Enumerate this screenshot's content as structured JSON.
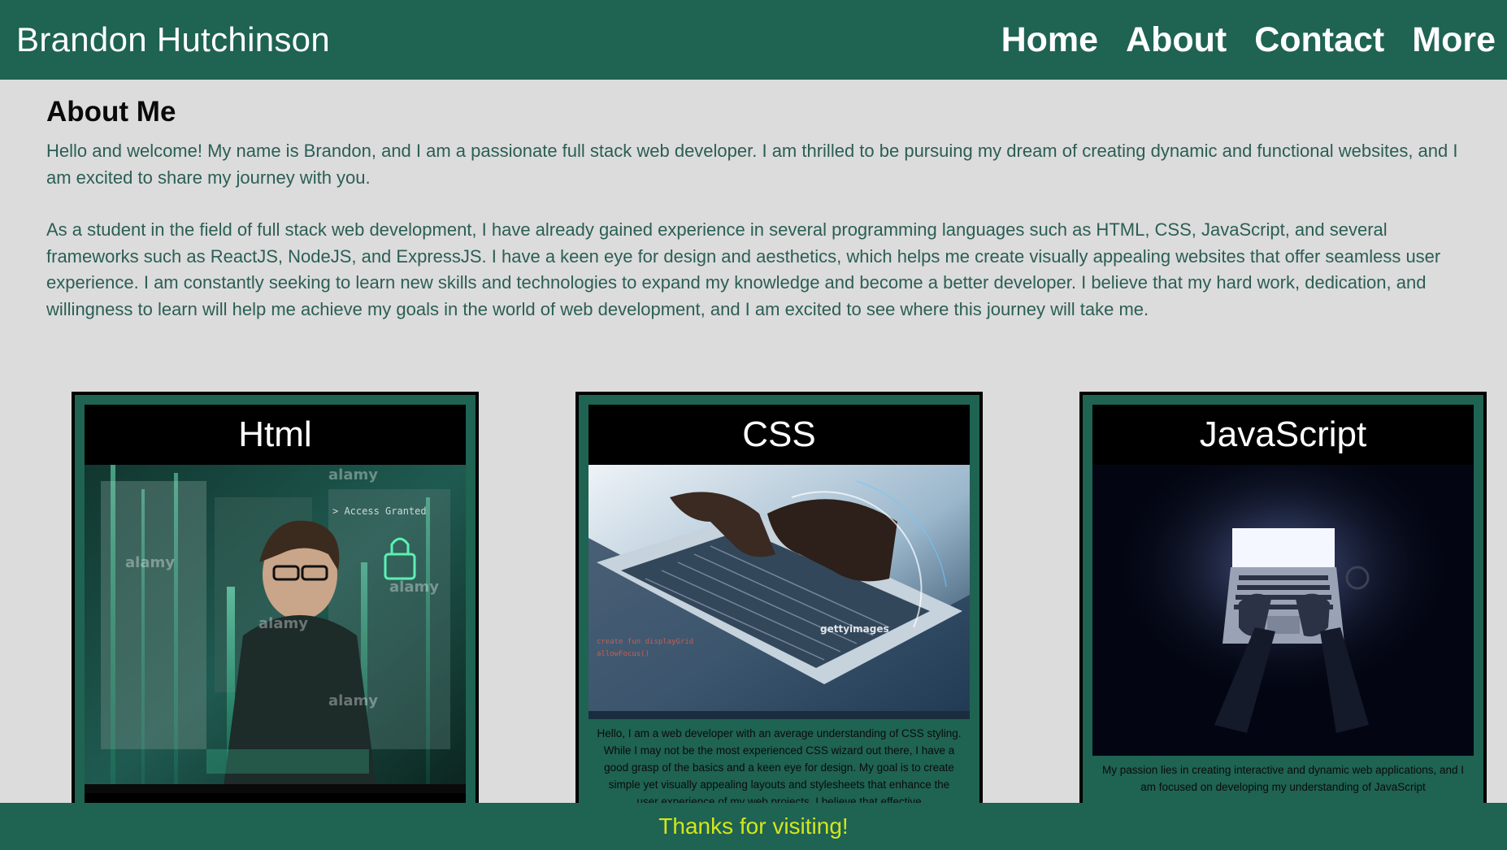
{
  "header": {
    "title": "Brandon Hutchinson",
    "nav": [
      "Home",
      "About",
      "Contact",
      "More"
    ]
  },
  "about": {
    "heading": "About Me",
    "paragraphs": [
      "Hello and welcome! My name is Brandon, and I am a passionate full stack web developer. I am thrilled to be pursuing my dream of creating dynamic and functional websites, and I am excited to share my journey with you.",
      "As a student in the field of full stack web development, I have already gained experience in several programming languages such as HTML, CSS, JavaScript, and several frameworks such as ReactJS, NodeJS, and ExpressJS. I have a keen eye for design and aesthetics, which helps me create visually appealing websites that offer seamless user experience. I am constantly seeking to learn new skills and technologies to expand my knowledge and become a better developer. I believe that my hard work, dedication, and willingness to learn will help me achieve my goals in the world of web development, and I am excited to see where this journey will take me."
    ]
  },
  "cards": [
    {
      "title": "Html",
      "image_icon": "hacker-code-image",
      "watermarks": [
        "alamy",
        "alamy",
        "alamy",
        "alamy",
        "alamy"
      ],
      "caption": "",
      "image_tag": "> Access Granted"
    },
    {
      "title": "CSS",
      "image_icon": "laptop-typing-image",
      "watermark": "gettyimages",
      "caption": "Hello, I am a web developer with an average understanding of CSS styling. While I may not be the most experienced CSS wizard out there, I have a good grasp of the basics and a keen eye for design. My goal is to create simple yet visually appealing layouts and stylesheets that enhance the user experience of my web projects. I believe that effective"
    },
    {
      "title": "JavaScript",
      "image_icon": "laptop-dark-image",
      "caption": "My passion lies in creating interactive and dynamic web applications, and I am focused on developing my understanding of JavaScript"
    }
  ],
  "footer": {
    "text": "Thanks for visiting!"
  },
  "colors": {
    "primary": "#1f6352",
    "background": "#dcdcdc",
    "footer_text": "#d4e61a",
    "body_text": "#2b5e54"
  }
}
